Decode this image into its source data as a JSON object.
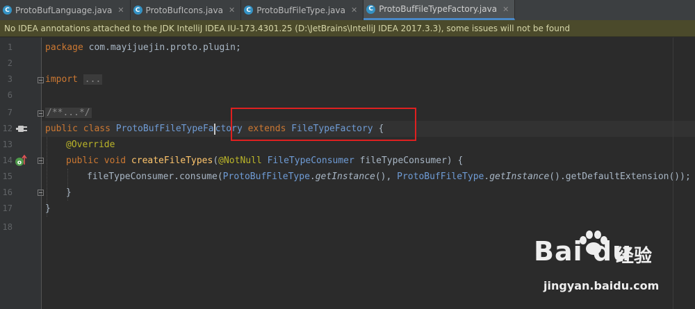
{
  "tabs": [
    {
      "label": "ProtoBufLanguage.java",
      "icon": "c-class-icon",
      "active": false
    },
    {
      "label": "ProtoBufIcons.java",
      "icon": "c-class-icon",
      "active": false
    },
    {
      "label": "ProtoBufFileType.java",
      "icon": "c-class-icon",
      "active": false
    },
    {
      "label": "ProtoBufFileTypeFactory.java",
      "icon": "c-class-icon",
      "active": true
    }
  ],
  "tab_icon_letter": "C",
  "tab_close": "✕",
  "banner": {
    "text": "No IDEA annotations attached to the JDK IntelliJ IDEA IU-173.4301.25 (D:\\JetBrains\\IntelliJ IDEA 2017.3.3), some issues will not be found"
  },
  "gutter": {
    "line_numbers": [
      "1",
      "2",
      "3",
      "6",
      "7",
      "12",
      "13",
      "14",
      "15",
      "16",
      "17",
      "18"
    ]
  },
  "code": {
    "l1_kw": "package",
    "l1_pkg": " com.mayijuejin.proto.plugin;",
    "l3_kw": "import",
    "l3_fold": "...",
    "l7_comment": "/**...*/",
    "l12_kw": "public class ",
    "l12_cls_a": "ProtoBufFileTypeFa",
    "l12_cls_b": "ctory",
    "l12_ext": " extends ",
    "l12_super": "FileTypeFactory",
    "l12_brace": " {",
    "l13_ann": "@Override",
    "l14_kw": "public void ",
    "l14_fn": "createFileTypes",
    "l14_paren": "(",
    "l14_ann": "@NotNull ",
    "l14_type": "FileTypeConsumer",
    "l14_param": " fileTypeConsumer) {",
    "l15_a": "fileTypeConsumer.consume(",
    "l15_cls1": "ProtoBufFileType",
    "l15_dot1": ".",
    "l15_gi1": "getInstance",
    "l15_b": "(), ",
    "l15_cls2": "ProtoBufFileType",
    "l15_dot2": ".",
    "l15_gi2": "getInstance",
    "l15_c": "().getDefaultExtension());",
    "l16": "}",
    "l17": "}"
  },
  "watermark": {
    "logo": "Bai du",
    "cn": "经验",
    "url": "jingyan.baidu.com"
  },
  "colors": {
    "keyword": "#cc7832",
    "class_ref": "#6f9cd6",
    "annotation": "#bbb529",
    "method": "#ffc66d",
    "highlight_box": "#e02020"
  }
}
